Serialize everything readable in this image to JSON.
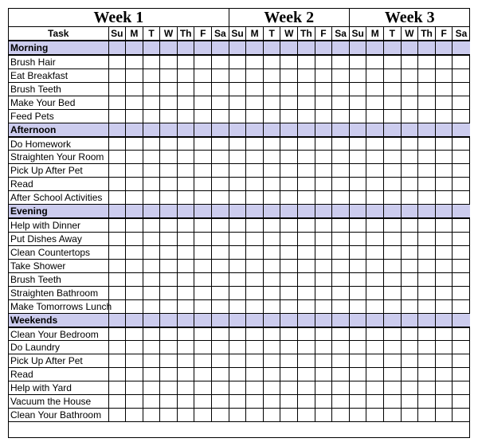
{
  "weeks": [
    "Week 1",
    "Week 2",
    "Week 3"
  ],
  "task_header": "Task",
  "days": [
    "Su",
    "M",
    "T",
    "W",
    "Th",
    "F",
    "Sa",
    "Su",
    "M",
    "T",
    "W",
    "Th",
    "F",
    "Sa",
    "Su",
    "M",
    "T",
    "W",
    "Th",
    "F",
    "Sa"
  ],
  "visible_days_count": 21,
  "sections": [
    {
      "name": "Morning",
      "tasks": [
        "Brush Hair",
        "Eat Breakfast",
        "Brush Teeth",
        "Make Your Bed",
        "Feed Pets"
      ]
    },
    {
      "name": "Afternoon",
      "tasks": [
        "Do Homework",
        "Straighten Your Room",
        "Pick Up After Pet",
        "Read",
        "After School Activities"
      ]
    },
    {
      "name": "Evening",
      "tasks": [
        "Help with Dinner",
        "Put Dishes Away",
        "Clean Countertops",
        "Take Shower",
        "Brush Teeth",
        "Straighten Bathroom",
        "Make Tomorrows Lunch"
      ]
    },
    {
      "name": "Weekends",
      "tasks": [
        "Clean Your Bedroom",
        "Do Laundry",
        "Pick Up After Pet",
        "Read",
        "Help with Yard",
        "Vacuum the House",
        "Clean Your Bathroom"
      ]
    }
  ],
  "colors": {
    "section_bg": "#ccccee"
  }
}
